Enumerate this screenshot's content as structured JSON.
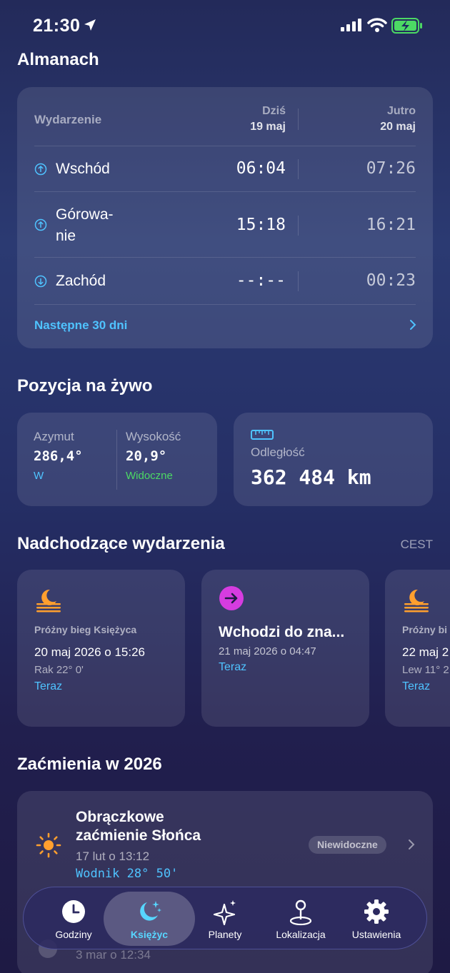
{
  "status_bar": {
    "time": "21:30"
  },
  "almanach": {
    "title": "Almanach",
    "header_event": "Wydarzenie",
    "col_today": {
      "label": "Dziś",
      "date": "19 maj"
    },
    "col_tomorrow": {
      "label": "Jutro",
      "date": "20 maj"
    },
    "rows": [
      {
        "label": "Wschód",
        "today": "06:04",
        "tomorrow": "07:26",
        "icon": "arrow-up-circle-icon"
      },
      {
        "label_line1": "Górowa-",
        "label_line2": "nie",
        "today": "15:18",
        "tomorrow": "16:21",
        "icon": "arrow-up-circle-icon"
      },
      {
        "label": "Zachód",
        "today": "--:--",
        "tomorrow": "00:23",
        "icon": "arrow-down-circle-icon"
      }
    ],
    "next_link": "Następne 30 dni"
  },
  "position": {
    "title": "Pozycja na żywo",
    "azimuth": {
      "label": "Azymut",
      "value": "286,4°",
      "sub": "W"
    },
    "altitude": {
      "label": "Wysokość",
      "value": "20,9°",
      "sub": "Widoczne"
    },
    "distance": {
      "label": "Odległość",
      "value": "362 484 km",
      "icon": "ruler-icon"
    }
  },
  "upcoming": {
    "title": "Nadchodzące wydarzenia",
    "timezone": "CEST",
    "events": [
      {
        "kind": "Próżny bieg Księżyca",
        "date": "20 maj 2026 o 15:26",
        "sign": "Rak 22° 0'",
        "now": "Teraz",
        "icon": "moonset-icon"
      },
      {
        "title": "Wchodzi do zna...",
        "date": "21 maj 2026 o 04:47",
        "now": "Teraz",
        "icon": "arrow-right-circle-icon"
      },
      {
        "kind": "Próżny bi",
        "date": "22 maj 2",
        "sign": "Lew 11° 2",
        "now": "Teraz",
        "icon": "moonset-icon"
      }
    ]
  },
  "eclipses": {
    "title": "Zaćmienia w 2026",
    "items": [
      {
        "name_line1": "Obrączkowe",
        "name_line2": "zaćmienie Słońca",
        "date": "17 lut o 13:12",
        "sign": "Wodnik 28° 50'",
        "badge": "Niewidoczne",
        "icon": "sun-icon"
      }
    ],
    "partial_next": {
      "date": "3 mar o 12:34"
    }
  },
  "tabbar": {
    "tabs": [
      {
        "label": "Godziny",
        "icon": "clock-icon"
      },
      {
        "label": "Księżyc",
        "icon": "moon-stars-icon",
        "active": true
      },
      {
        "label": "Planety",
        "icon": "sparkles-icon"
      },
      {
        "label": "Lokalizacja",
        "icon": "location-pin-icon"
      },
      {
        "label": "Ustawienia",
        "icon": "gear-icon"
      }
    ]
  },
  "colors": {
    "accent": "#4fc3ff",
    "visible_green": "#4cd964",
    "sun_orange": "#ff9f2e",
    "event_magenta": "#d63ce0"
  }
}
